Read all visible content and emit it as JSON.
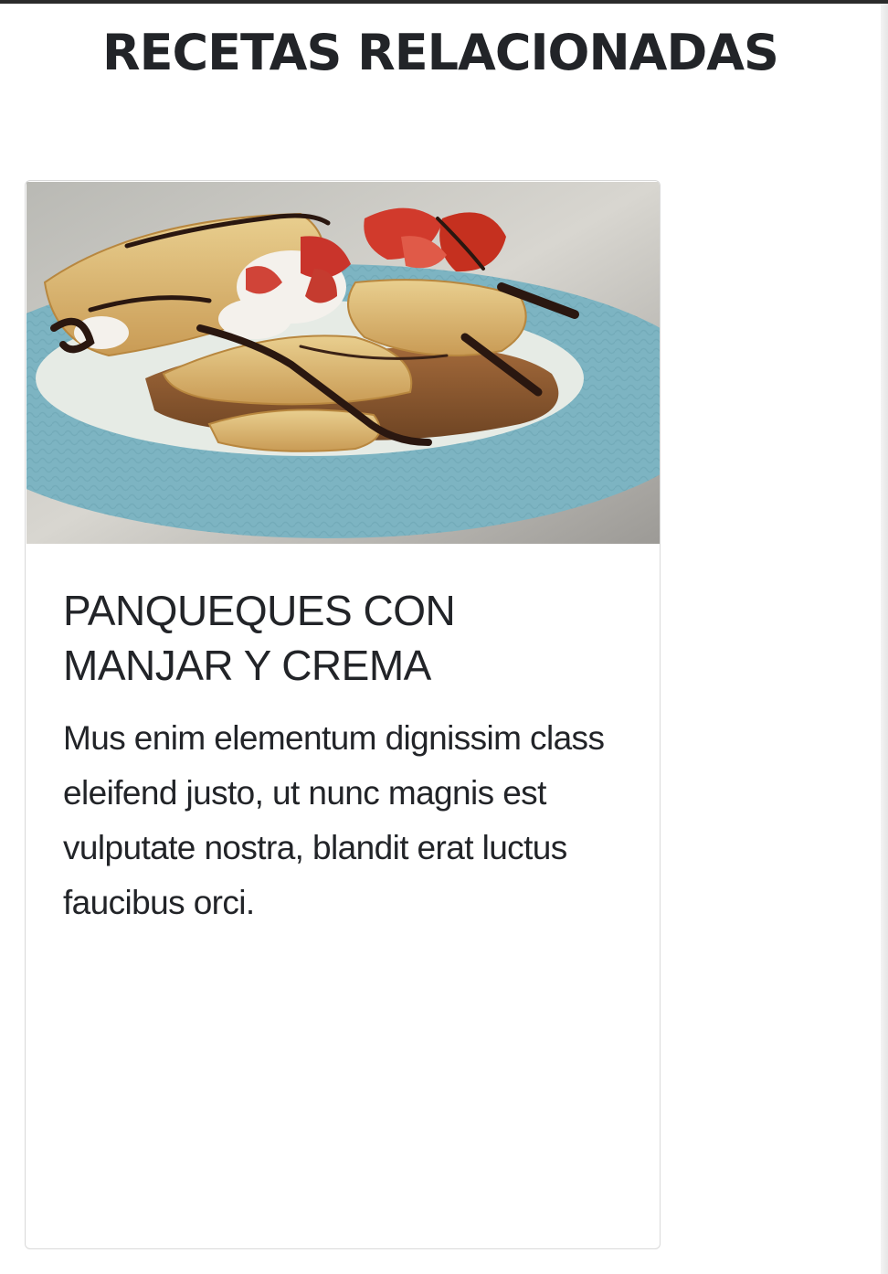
{
  "section": {
    "title": "RECETAS RELACIONADAS"
  },
  "card": {
    "image_alt": "Panqueques con manjar y crema",
    "title": "PANQUEQUES CON MANJAR Y CREMA",
    "description": "Mus enim elementum dignissim class eleifend justo, ut nunc magnis est vulputate nostra, blandit erat luctus faucibus orci."
  },
  "colors": {
    "text": "#222428",
    "card_border": "#d9d9d9",
    "plate": "#8cc3cf",
    "manjar": "#8a5a32"
  }
}
